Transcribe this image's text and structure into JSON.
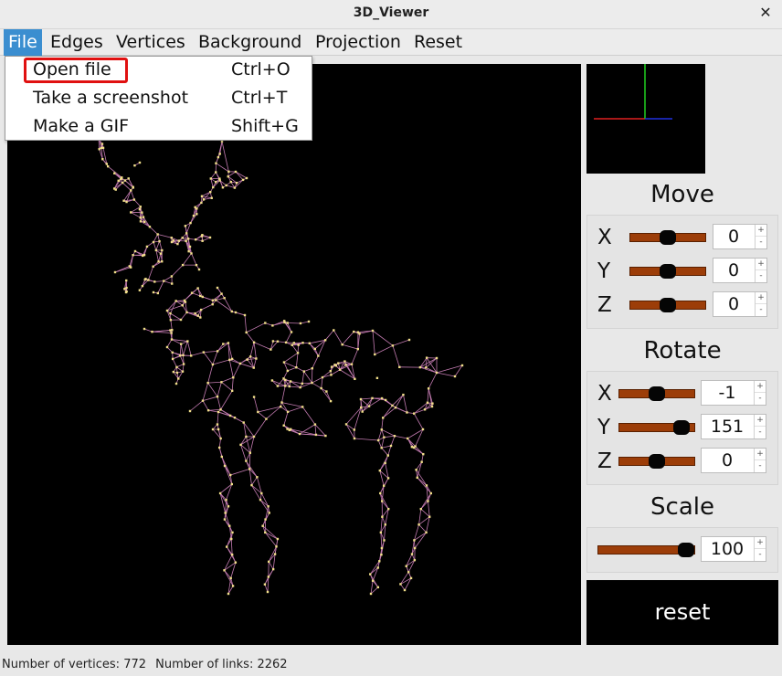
{
  "window": {
    "title": "3D_Viewer"
  },
  "menu": [
    {
      "label": "File",
      "active": true
    },
    {
      "label": "Edges"
    },
    {
      "label": "Vertices"
    },
    {
      "label": "Background"
    },
    {
      "label": "Projection"
    },
    {
      "label": "Reset"
    }
  ],
  "file_menu": [
    {
      "label": "Open file",
      "shortcut": "Ctrl+O",
      "highlighted": true
    },
    {
      "label": "Take a screenshot",
      "shortcut": "Ctrl+T"
    },
    {
      "label": "Make a GIF",
      "shortcut": "Shift+G"
    }
  ],
  "move": {
    "title": "Move",
    "rows": [
      {
        "axis": "X",
        "value": "0",
        "level": 0.5
      },
      {
        "axis": "Y",
        "value": "0",
        "level": 0.5
      },
      {
        "axis": "Z",
        "value": "0",
        "level": 0.5
      }
    ]
  },
  "rotate": {
    "title": "Rotate",
    "rows": [
      {
        "axis": "X",
        "value": "-1",
        "level": 0.5
      },
      {
        "axis": "Y",
        "value": "151",
        "level": 0.92
      },
      {
        "axis": "Z",
        "value": "0",
        "level": 0.5
      }
    ]
  },
  "scale": {
    "title": "Scale",
    "value": "100",
    "level": 1.0
  },
  "reset_label": "reset",
  "status": {
    "vertices": "Number of vertices: 772",
    "links": "Number of links: 2262"
  },
  "colors": {
    "edges": "#c27ab0",
    "vertices": "#f2e08a",
    "background": "#000000",
    "slider": "#9c3d08",
    "axis_x": "#e02020",
    "axis_y": "#20d020",
    "axis_z": "#2030e0"
  }
}
